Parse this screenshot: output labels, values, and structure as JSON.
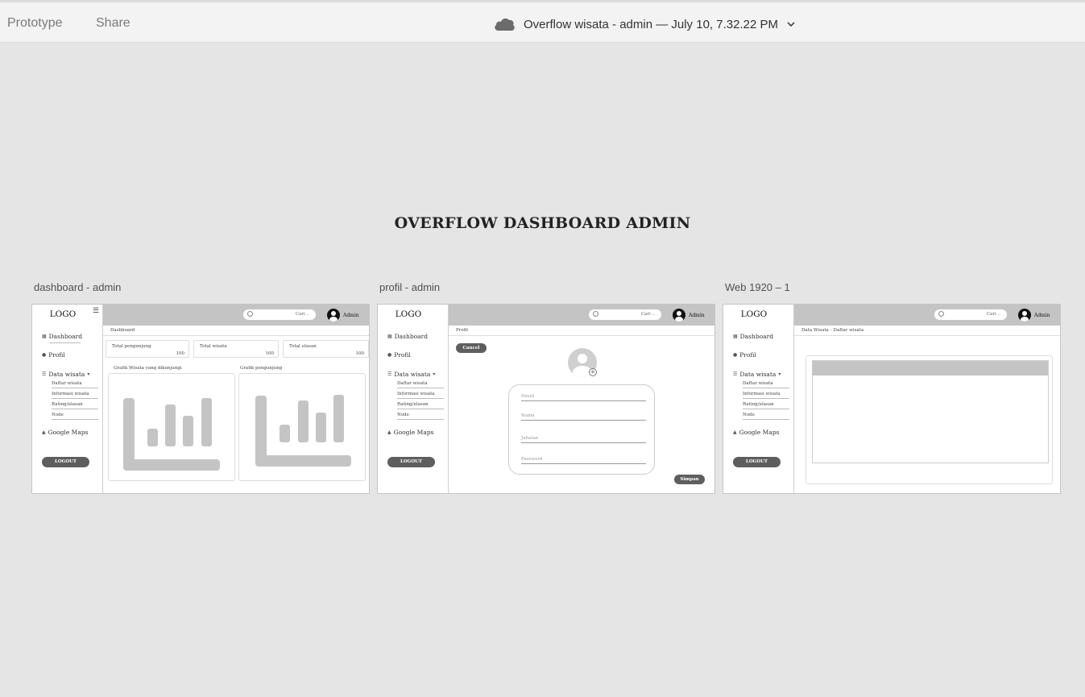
{
  "toolbar": {
    "tabs": [
      "Prototype",
      "Share"
    ],
    "doc_title": "Overflow wisata - admin — July 10, 7.32.22 PM"
  },
  "canvas": {
    "title": "OVERFLOW DASHBOARD ADMIN"
  },
  "artboards": [
    {
      "label": "dashboard - admin",
      "logo": "LOGO",
      "nav": {
        "dashboard": "Dashboard",
        "profil": "Profil",
        "data_wisata": "Data wisata",
        "sub": [
          "Daftar wisata",
          "Informasi wisata",
          "Rating/ulasan",
          "Node"
        ],
        "maps": "Google Maps",
        "logout": "LOGOUT"
      },
      "search": "Cari ..",
      "admin": "Admin",
      "breadcrumb": "Dashboard",
      "stats": [
        {
          "label": "Total pengunjung",
          "value": "100"
        },
        {
          "label": "Total wisata",
          "value": "100"
        },
        {
          "label": "Total ulasan",
          "value": "100"
        }
      ],
      "charts": [
        "Grafik Wisata yang dikunjungi",
        "Grafik pengunjung"
      ]
    },
    {
      "label": "profil - admin",
      "logo": "LOGO",
      "nav": {
        "dashboard": "Dashboard",
        "profil": "Profil",
        "data_wisata": "Data wisata",
        "sub": [
          "Daftar wisata",
          "Informasi wisata",
          "Rating/ulasan",
          "Node"
        ],
        "maps": "Google Maps",
        "logout": "LOGOUT"
      },
      "search": "Cari ..",
      "admin": "Admin",
      "breadcrumb": "Profil",
      "cancel": "Cancel",
      "fields": [
        "Email",
        "Nama",
        "Jabatan",
        "Password"
      ],
      "save": "Simpan"
    },
    {
      "label": "Web 1920 – 1",
      "logo": "LOGO",
      "nav": {
        "dashboard": "Dashboard",
        "profil": "Profil",
        "data_wisata": "Data wisata",
        "sub": [
          "Daftar wisata",
          "Informasi wisata",
          "Rating/ulasan",
          "Node"
        ],
        "maps": "Google Maps",
        "logout": "LOGOUT"
      },
      "search": "Cari ..",
      "admin": "Admin",
      "breadcrumb": [
        "Data Wisata",
        "Daftar wisata"
      ]
    }
  ]
}
